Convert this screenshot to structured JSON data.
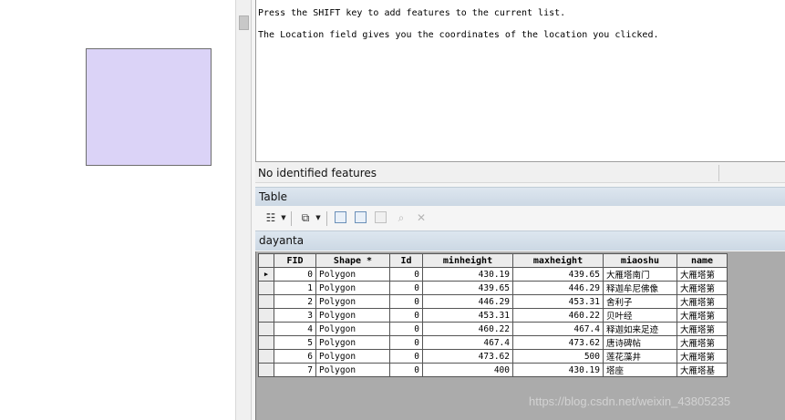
{
  "map": {
    "polygon_fill": "#dbd3f7",
    "polygon_stroke": "#6e6e6e"
  },
  "identify": {
    "lines": [
      "Press the SHIFT key to add features to the current list.",
      "The Location field gives you the coordinates of the location you clicked."
    ],
    "status": "No identified features"
  },
  "table_window": {
    "title": "Table",
    "toolbar": {
      "icons": [
        "table-options-icon",
        "related-tables-icon",
        "select-by-attributes-icon",
        "switch-selection-icon",
        "clear-selection-icon",
        "zoom-to-selected-icon",
        "delete-selected-icon"
      ]
    },
    "dataset_tab": "dayanta"
  },
  "attribute_table": {
    "columns": [
      "FID",
      "Shape *",
      "Id",
      "minheight",
      "maxheight",
      "miaoshu",
      "name"
    ],
    "rows": [
      {
        "FID": "0",
        "Shape": "Polygon",
        "Id": "0",
        "minheight": "430.19",
        "maxheight": "439.65",
        "miaoshu": "大雁塔南门",
        "name": "大雁塔第"
      },
      {
        "FID": "1",
        "Shape": "Polygon",
        "Id": "0",
        "minheight": "439.65",
        "maxheight": "446.29",
        "miaoshu": "释迦牟尼佛像",
        "name": "大雁塔第"
      },
      {
        "FID": "2",
        "Shape": "Polygon",
        "Id": "0",
        "minheight": "446.29",
        "maxheight": "453.31",
        "miaoshu": "舍利子",
        "name": "大雁塔第"
      },
      {
        "FID": "3",
        "Shape": "Polygon",
        "Id": "0",
        "minheight": "453.31",
        "maxheight": "460.22",
        "miaoshu": "贝叶经",
        "name": "大雁塔第"
      },
      {
        "FID": "4",
        "Shape": "Polygon",
        "Id": "0",
        "minheight": "460.22",
        "maxheight": "467.4",
        "miaoshu": "释迦如来足迹",
        "name": "大雁塔第"
      },
      {
        "FID": "5",
        "Shape": "Polygon",
        "Id": "0",
        "minheight": "467.4",
        "maxheight": "473.62",
        "miaoshu": "唐诗碑帖",
        "name": "大雁塔第"
      },
      {
        "FID": "6",
        "Shape": "Polygon",
        "Id": "0",
        "minheight": "473.62",
        "maxheight": "500",
        "miaoshu": "莲花藻井",
        "name": "大雁塔第"
      },
      {
        "FID": "7",
        "Shape": "Polygon",
        "Id": "0",
        "minheight": "400",
        "maxheight": "430.19",
        "miaoshu": "塔座",
        "name": "大雁塔基"
      }
    ],
    "current_row_marker": "▶"
  },
  "watermark": "https://blog.csdn.net/weixin_43805235"
}
